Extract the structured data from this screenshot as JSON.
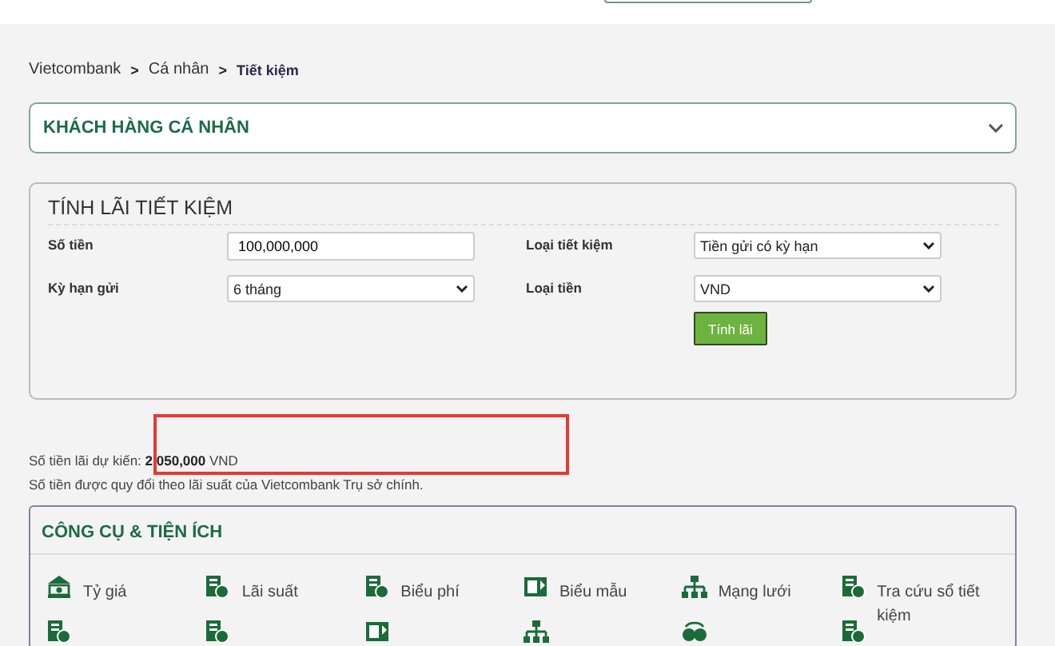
{
  "breadcrumb": [
    {
      "label": "Vietcombank",
      "current": false
    },
    {
      "label": "Cá nhân",
      "current": false
    },
    {
      "label": "Tiết kiệm",
      "current": true
    }
  ],
  "breadcrumb_separator": ">",
  "customer_select": {
    "value": "KHÁCH HÀNG CÁ NHÂN"
  },
  "calculator": {
    "title": "TÍNH LÃI TIẾT KIỆM",
    "fields": [
      {
        "label": "Số tiền",
        "kind": "input",
        "value": "100,000,000"
      },
      {
        "label": "Loại tiết kiệm",
        "kind": "select",
        "value": "Tiền gửi có kỳ hạn"
      },
      {
        "label": "Kỳ hạn gửi",
        "kind": "select",
        "value": "6 tháng"
      },
      {
        "label": "Loại tiền",
        "kind": "select",
        "value": "VND"
      }
    ],
    "button": "Tính lãi"
  },
  "result": {
    "label": "Số tiền lãi dự kiến:",
    "amount": "2,050,000",
    "currency": "VND",
    "note": "Số tiền được quy đổi theo lãi suất của Vietcombank Trụ sở chính.",
    "highlighted": true
  },
  "tools": {
    "title": "CÔNG CỤ & TIỆN ÍCH",
    "items": [
      {
        "label": "Tỷ giá"
      },
      {
        "label": "Lãi suất"
      },
      {
        "label": "Biểu phí"
      },
      {
        "label": "Biểu mẫu"
      },
      {
        "label": "Mạng lưới"
      },
      {
        "label": "Tra cứu sổ tiết kiệm"
      }
    ]
  }
}
